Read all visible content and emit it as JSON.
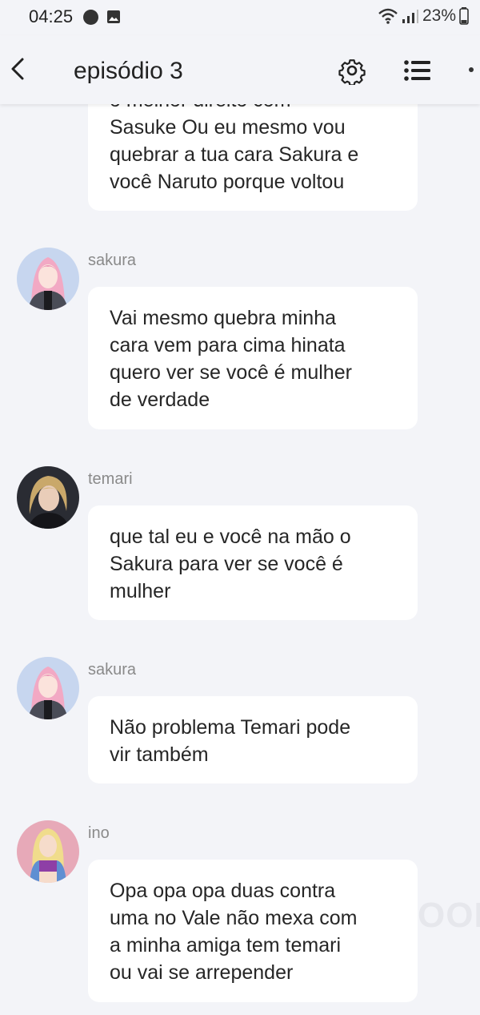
{
  "status_bar": {
    "time": "04:25",
    "battery": "23%"
  },
  "header": {
    "title": "episódio 3"
  },
  "messages": [
    {
      "sender": "",
      "lines": [
        "o melhor direito com",
        "Sasuke Ou eu mesmo vou",
        "quebrar a tua cara Sakura e",
        "você Naruto porque voltou"
      ]
    },
    {
      "sender": "sakura",
      "lines": [
        "Vai mesmo quebra minha",
        "cara vem para cima hinata",
        "quero ver se você é mulher",
        "de verdade"
      ]
    },
    {
      "sender": "temari",
      "lines": [
        "que tal eu e você na mão o",
        "Sakura para ver se você é",
        "mulher"
      ]
    },
    {
      "sender": "sakura",
      "lines": [
        "Não problema Temari pode",
        "vir também"
      ]
    },
    {
      "sender": "ino",
      "lines": [
        "Opa opa opa duas contra",
        "uma no Vale não mexa com",
        "a minha amiga tem temari",
        "ou vai se arrepender"
      ]
    }
  ],
  "watermark": "OON",
  "colors": {
    "background": "#f3f4f8",
    "bubble": "#ffffff",
    "sender_name": "#8a8a8a"
  }
}
